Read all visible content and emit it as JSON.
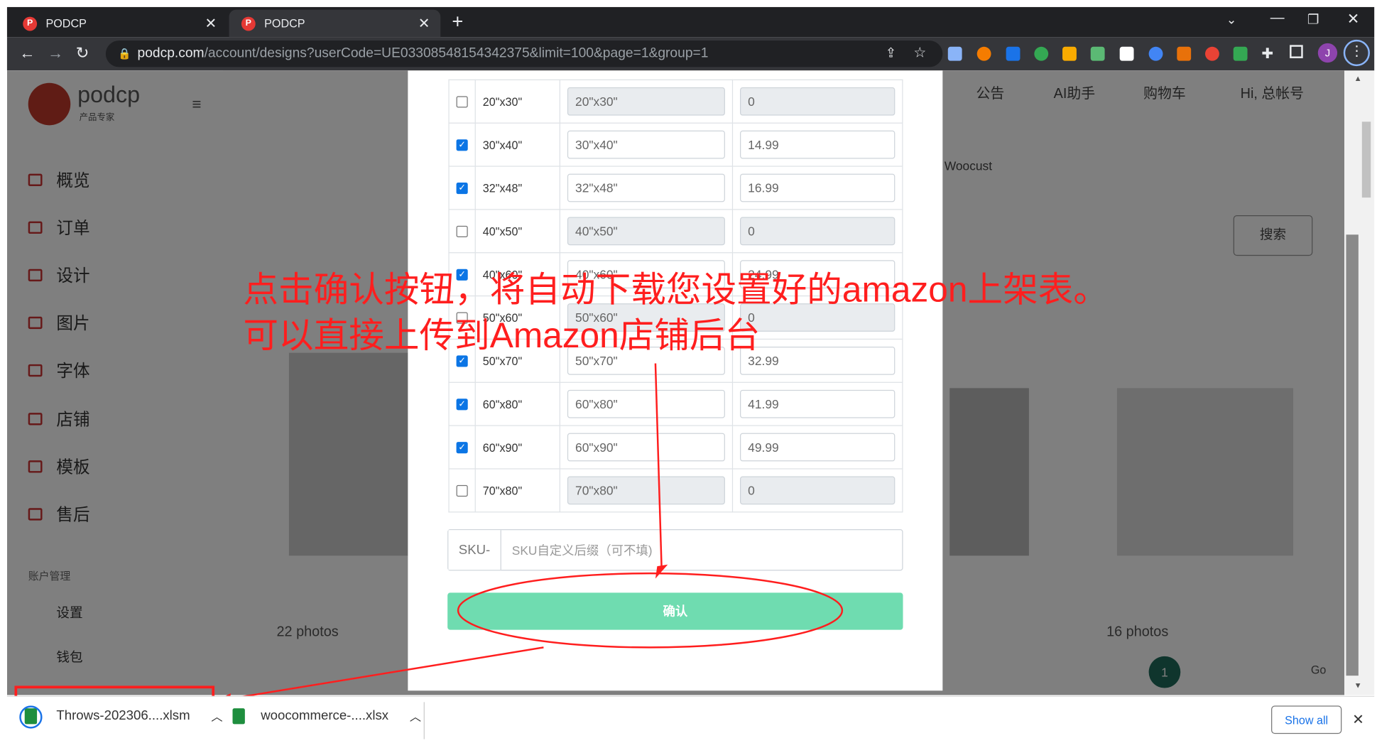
{
  "browser": {
    "tabs": [
      {
        "title": "PODCP"
      },
      {
        "title": "PODCP"
      }
    ],
    "new_tab": "+",
    "url_host": "podcp.com",
    "url_path": "/account/designs?userCode=UE03308548154342375&limit=100&page=1&group=1",
    "profile_initial": "J"
  },
  "sidebar": {
    "logo": "podcp",
    "logo_sub": "产品专家",
    "items": [
      {
        "label": "概览"
      },
      {
        "label": "订单"
      },
      {
        "label": "设计"
      },
      {
        "label": "图片"
      },
      {
        "label": "字体"
      },
      {
        "label": "店铺"
      },
      {
        "label": "模板"
      },
      {
        "label": "售后"
      }
    ],
    "section": "账户管理",
    "settings": "设置",
    "wallet": "钱包"
  },
  "header": {
    "notice": "公告",
    "ai": "AI助手",
    "cart": "购物车",
    "user": "Hi, 总帐号"
  },
  "background": {
    "search_btn": "搜索",
    "photos_left": "22 photos",
    "photos_right": "16 photos",
    "page_current": "1",
    "go": "Go",
    "woocust": "Woocust"
  },
  "modal": {
    "rows": [
      {
        "size": "20\"x30\"",
        "name": "20\"x30\"",
        "price": "0",
        "checked": false
      },
      {
        "size": "30\"x40\"",
        "name": "30\"x40\"",
        "price": "14.99",
        "checked": true
      },
      {
        "size": "32\"x48\"",
        "name": "32\"x48\"",
        "price": "16.99",
        "checked": true
      },
      {
        "size": "40\"x50\"",
        "name": "40\"x50\"",
        "price": "0",
        "checked": false
      },
      {
        "size": "40\"x60\"",
        "name": "40\"x60\"",
        "price": "24.99",
        "checked": true
      },
      {
        "size": "50\"x60\"",
        "name": "50\"x60\"",
        "price": "0",
        "checked": false
      },
      {
        "size": "50\"x70\"",
        "name": "50\"x70\"",
        "price": "32.99",
        "checked": true
      },
      {
        "size": "60\"x80\"",
        "name": "60\"x80\"",
        "price": "41.99",
        "checked": true
      },
      {
        "size": "60\"x90\"",
        "name": "60\"x90\"",
        "price": "49.99",
        "checked": true
      },
      {
        "size": "70\"x80\"",
        "name": "70\"x80\"",
        "price": "0",
        "checked": false
      }
    ],
    "sku_prefix": "SKU-",
    "sku_placeholder": "SKU自定义后缀（可不填)",
    "confirm_label": "确认"
  },
  "annotation": {
    "line1": "点击确认按钮，将自动下载您设置好的amazon上架表。",
    "line2": "可以直接上传到Amazon店铺后台"
  },
  "downloads": {
    "items": [
      {
        "name": "Throws-202306....xlsm"
      },
      {
        "name": "woocommerce-....xlsx"
      }
    ],
    "show_all": "Show all",
    "close": "✕"
  },
  "colors": {
    "confirm": "#6fdcb0",
    "annotation": "#ff1e1e",
    "checkbox": "#0b75e5"
  }
}
